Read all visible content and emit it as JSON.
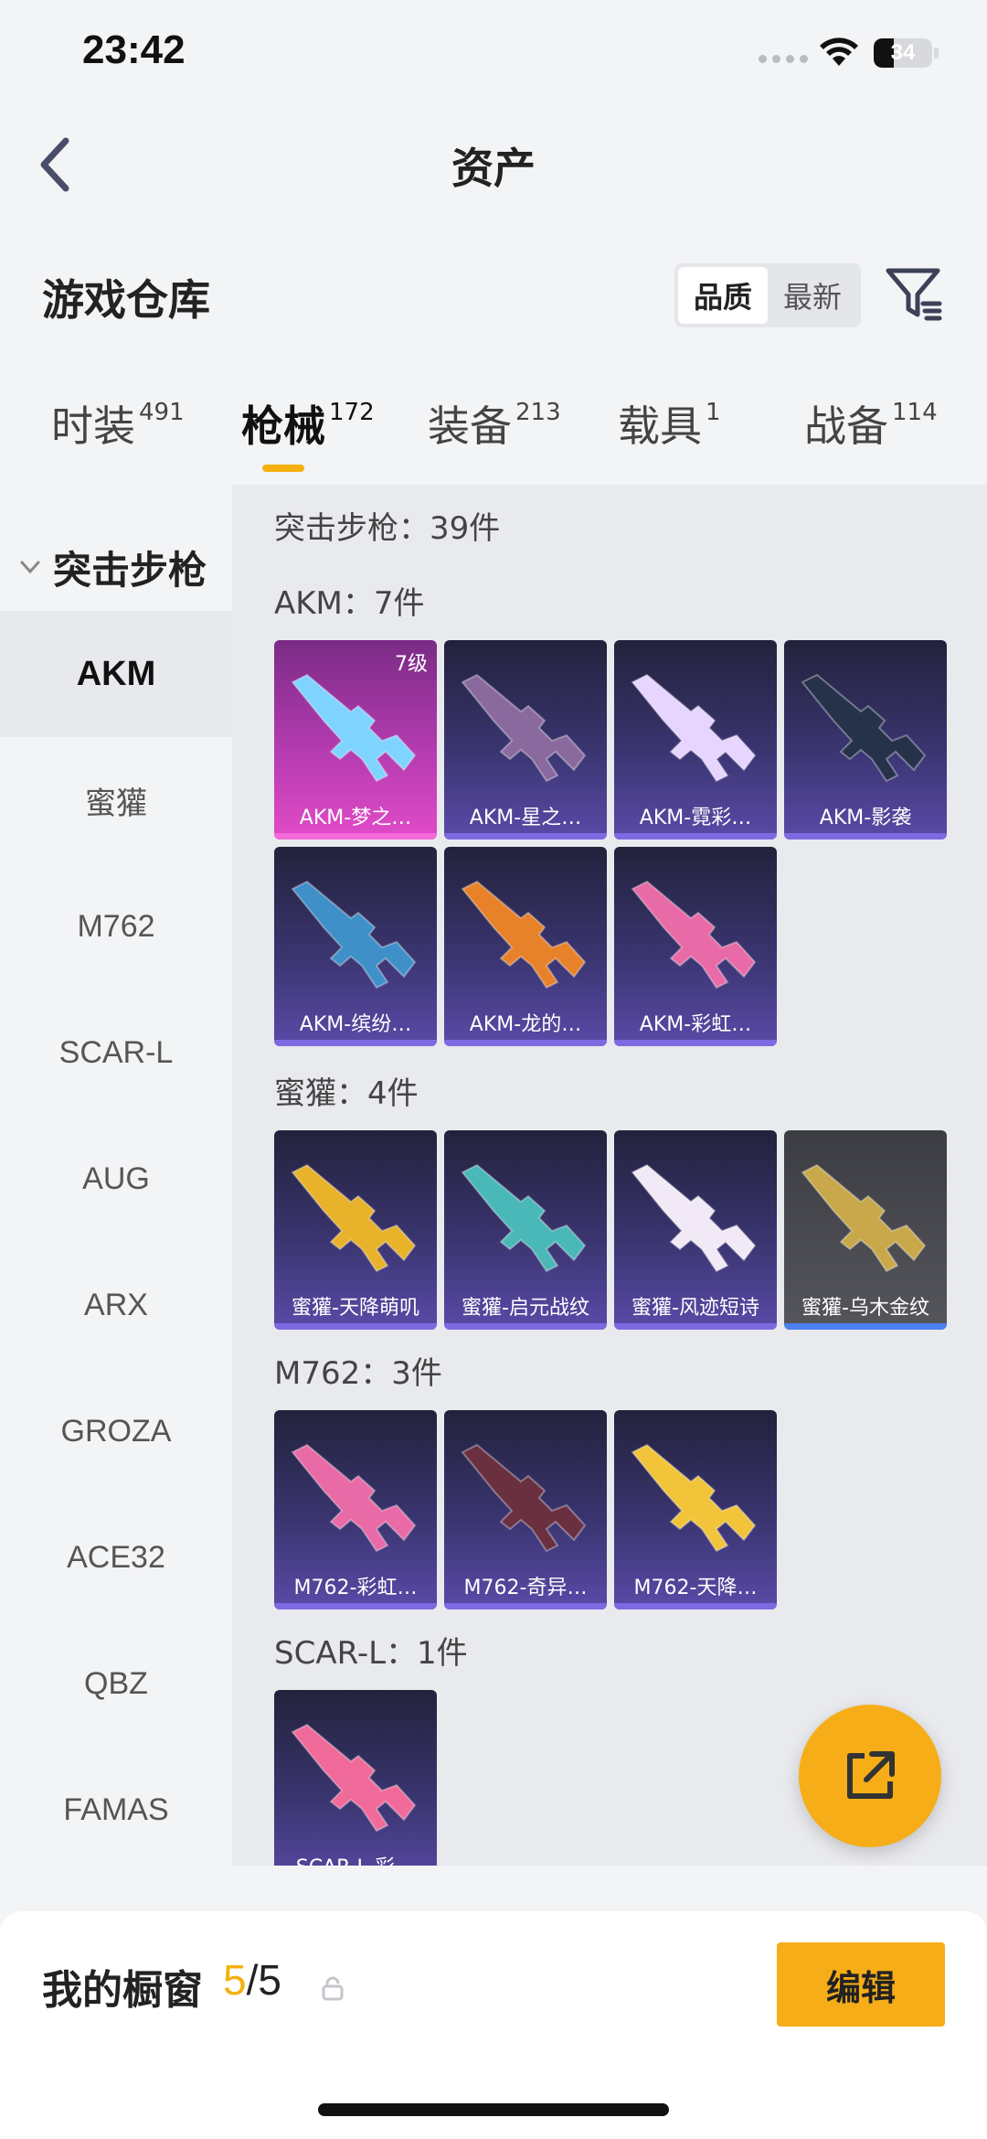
{
  "status_bar": {
    "time": "23:42",
    "battery": "34",
    "battery_level": 0.34
  },
  "header": {
    "title": "资产"
  },
  "warehouse": {
    "title": "游戏仓库",
    "sort_options": [
      {
        "label": "品质",
        "active": true
      },
      {
        "label": "最新",
        "active": false
      }
    ]
  },
  "tabs": [
    {
      "label": "时装",
      "count": "491",
      "active": false
    },
    {
      "label": "枪械",
      "count": "172",
      "active": true
    },
    {
      "label": "装备",
      "count": "213",
      "active": false
    },
    {
      "label": "载具",
      "count": "1",
      "active": false
    },
    {
      "label": "战备",
      "count": "114",
      "active": false
    }
  ],
  "sidebar": {
    "group": "突击步枪",
    "items": [
      {
        "label": "AKM",
        "active": true
      },
      {
        "label": "蜜獾",
        "active": false
      },
      {
        "label": "M762",
        "active": false
      },
      {
        "label": "SCAR-L",
        "active": false
      },
      {
        "label": "AUG",
        "active": false
      },
      {
        "label": "ARX",
        "active": false
      },
      {
        "label": "GROZA",
        "active": false
      },
      {
        "label": "ACE32",
        "active": false
      },
      {
        "label": "QBZ",
        "active": false
      },
      {
        "label": "FAMAS",
        "active": false
      }
    ]
  },
  "content": {
    "total_heading": "突击步枪：39件",
    "sections": [
      {
        "heading": "AKM：7件",
        "items": [
          {
            "name": "AKM-梦之…",
            "level": "7级",
            "style": "pink",
            "gun_color": "#7fd3ff"
          },
          {
            "name": "AKM-星之…",
            "level": "",
            "style": "purple",
            "gun_color": "#8a6a9e"
          },
          {
            "name": "AKM-霓彩…",
            "level": "",
            "style": "purple",
            "gun_color": "#e7d4ff"
          },
          {
            "name": "AKM-影袭",
            "level": "",
            "style": "purple",
            "gun_color": "#26324a"
          },
          {
            "name": "AKM-缤纷…",
            "level": "",
            "style": "purple",
            "gun_color": "#3f8fc8"
          },
          {
            "name": "AKM-龙的…",
            "level": "",
            "style": "purple",
            "gun_color": "#e8822a"
          },
          {
            "name": "AKM-彩虹…",
            "level": "",
            "style": "purple",
            "gun_color": "#e86aa6"
          }
        ]
      },
      {
        "heading": "蜜獾：4件",
        "items": [
          {
            "name": "蜜獾-天降萌叽",
            "level": "",
            "style": "purple",
            "gun_color": "#e8b22a"
          },
          {
            "name": "蜜獾-启元战纹",
            "level": "",
            "style": "purple",
            "gun_color": "#4ab8b8"
          },
          {
            "name": "蜜獾-风迹短诗",
            "level": "",
            "style": "purple",
            "gun_color": "#f1eaf6"
          },
          {
            "name": "蜜獾-乌木金纹",
            "level": "",
            "style": "gray",
            "gun_color": "#c8a84a"
          }
        ]
      },
      {
        "heading": "M762：3件",
        "items": [
          {
            "name": "M762-彩虹…",
            "level": "",
            "style": "purple",
            "gun_color": "#e86aa6"
          },
          {
            "name": "M762-奇异…",
            "level": "",
            "style": "purple",
            "gun_color": "#6a3040"
          },
          {
            "name": "M762-天降…",
            "level": "",
            "style": "purple",
            "gun_color": "#f2c43a"
          }
        ]
      },
      {
        "heading": "SCAR-L：1件",
        "items": [
          {
            "name": "SCAR-L-彩…",
            "level": "",
            "style": "purple",
            "gun_color": "#f06a9a"
          }
        ]
      }
    ]
  },
  "bottom_bar": {
    "showcase_label": "我的橱窗",
    "used": "5",
    "total": "/5",
    "edit_label": "编辑"
  }
}
